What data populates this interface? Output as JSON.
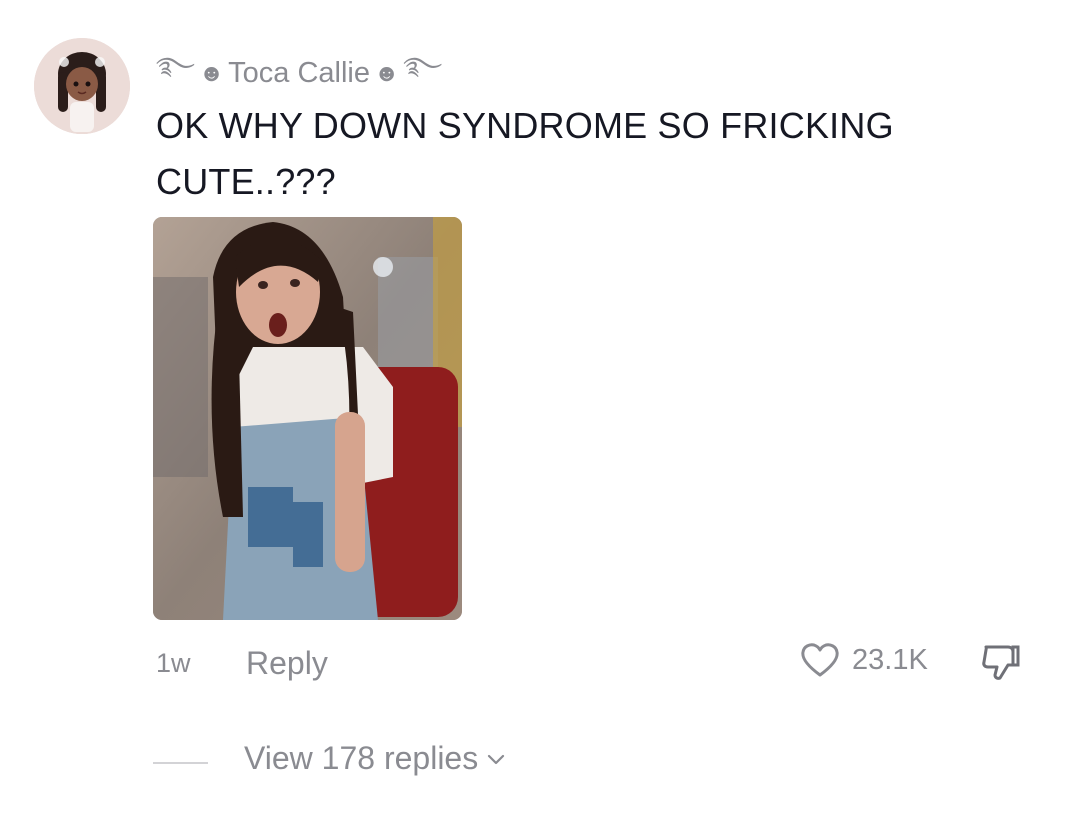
{
  "comment": {
    "username": "Toca Callie",
    "username_decoration": [
      "࿐",
      "☻",
      "☻",
      "࿐"
    ],
    "text": "OK WHY DOWN SYNDROME SO FRICKING CUTE..???",
    "time": "1w",
    "reply_label": "Reply",
    "like_count": "23.1K",
    "view_replies_label": "View 178 replies",
    "icons": {
      "like": "heart-outline-icon",
      "dislike": "thumbs-down-icon",
      "expand": "chevron-down-icon"
    }
  },
  "colors": {
    "text_primary": "#161823",
    "text_secondary": "#8a8b91",
    "background": "#ffffff"
  }
}
